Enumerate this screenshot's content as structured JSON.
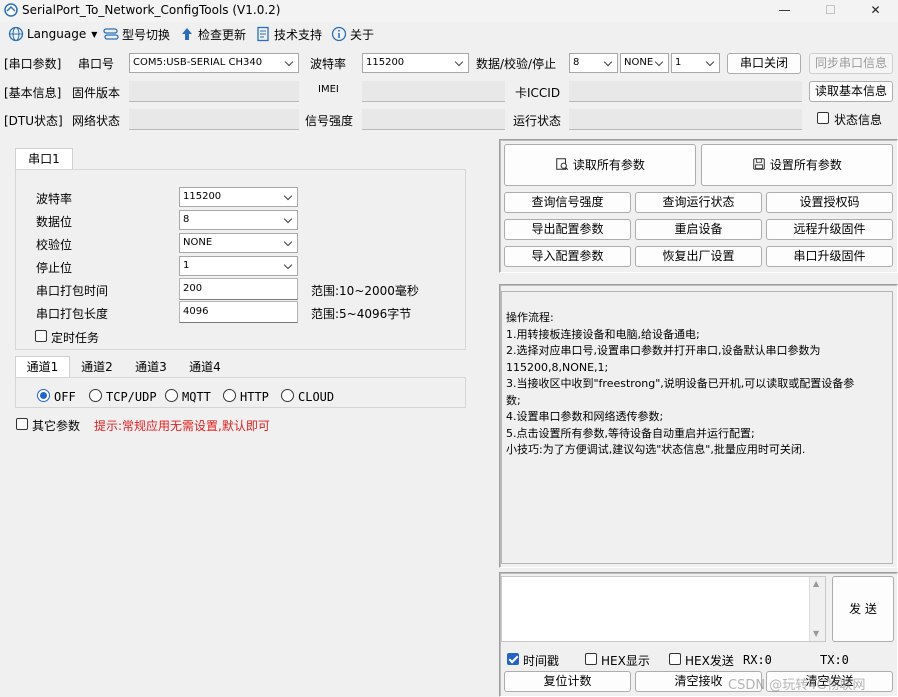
{
  "window": {
    "title": "SerialPort_To_Network_ConfigTools (V1.0.2)",
    "minimize": "—",
    "maximize": "☐",
    "close": "✕"
  },
  "menu": {
    "language": "Language",
    "model_switch": "型号切换",
    "check_update": "检查更新",
    "tech_support": "技术支持",
    "about": "关于"
  },
  "serial_row": {
    "section": "[串口参数]",
    "port_label": "串口号",
    "port_value": "COM5:USB-SERIAL CH340",
    "baud_label": "波特率",
    "baud_value": "115200",
    "dps_label": "数据/校验/停止",
    "data_bits": "8",
    "parity": "NONE",
    "stop_bits": "1",
    "close_port_button": "串口关闭",
    "sync_button": "同步串口信息"
  },
  "basic_row": {
    "section": "[基本信息]",
    "firmware_label": "固件版本",
    "imei_label": "IMEI",
    "iccid_label": "卡ICCID",
    "read_basic_button": "读取基本信息"
  },
  "dtu_row": {
    "section": "[DTU状态]",
    "network_label": "网络状态",
    "signal_label": "信号强度",
    "run_label": "运行状态",
    "status_info_label": "状态信息",
    "status_info_checked": false
  },
  "port_panel": {
    "tab": "串口1",
    "baud_label": "波特率",
    "baud_value": "115200",
    "data_label": "数据位",
    "data_value": "8",
    "parity_label": "校验位",
    "parity_value": "NONE",
    "stop_label": "停止位",
    "stop_value": "1",
    "pack_time_label": "串口打包时间",
    "pack_time_value": "200",
    "pack_time_range": "范围:10~2000毫秒",
    "pack_len_label": "串口打包长度",
    "pack_len_value": "4096",
    "pack_len_range": "范围:5~4096字节",
    "timer_label": "定时任务",
    "timer_checked": false
  },
  "channels": {
    "tabs": [
      "通道1",
      "通道2",
      "通道3",
      "通道4"
    ],
    "active_tab": 0,
    "protocols": [
      "OFF",
      "TCP/UDP",
      "MQTT",
      "HTTP",
      "CLOUD"
    ],
    "selected_protocol": 0
  },
  "other_params": {
    "label": "其它参数",
    "checked": false,
    "hint": "提示:常规应用无需设置,默认即可",
    "hint_color": "#e02020"
  },
  "actions": {
    "read_all": "读取所有参数",
    "set_all": "设置所有参数",
    "buttons": [
      [
        "查询信号强度",
        "查询运行状态",
        "设置授权码"
      ],
      [
        "导出配置参数",
        "重启设备",
        "远程升级固件"
      ],
      [
        "导入配置参数",
        "恢复出厂设置",
        "串口升级固件"
      ]
    ]
  },
  "log": {
    "lines": [
      "操作流程:",
      "1.用转接板连接设备和电脑,给设备通电;",
      "2.选择对应串口号,设置串口参数并打开串口,设备默认串口参数为",
      "115200,8,NONE,1;",
      "3.当接收区中收到\"freestrong\",说明设备已开机,可以读取或配置设备参",
      "数;",
      "4.设置串口参数和网络透传参数;",
      "5.点击设置所有参数,等待设备自动重启并运行配置;",
      "小技巧:为了方便调试,建议勾选\"状态信息\",批量应用时可关闭."
    ]
  },
  "send": {
    "button": "发 送",
    "timestamp_label": "时间戳",
    "timestamp_checked": true,
    "hex_show_label": "HEX显示",
    "hex_show_checked": false,
    "hex_send_label": "HEX发送",
    "hex_send_checked": false,
    "rx": "RX:0",
    "tx": "TX:0",
    "reset_count": "复位计数",
    "clear_recv": "清空接收",
    "clear_send": "清空发送"
  },
  "watermark": "CSDN @玩转4G物联网",
  "colors": {
    "accent": "#2563c7",
    "background": "#f0f0f0"
  }
}
